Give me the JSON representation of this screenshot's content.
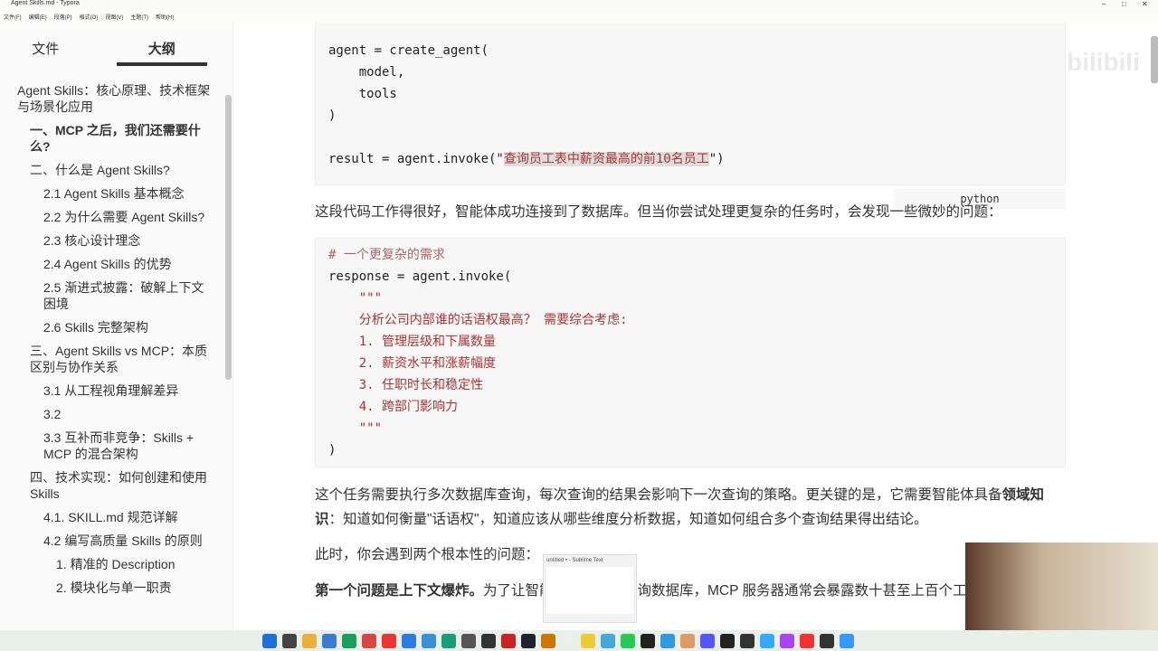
{
  "window": {
    "title": "Agent Skills.md - Typora"
  },
  "menu": [
    "文件(F)",
    "编辑(E)",
    "段落(P)",
    "格式(O)",
    "视图(V)",
    "主题(T)",
    "帮助(H)"
  ],
  "sidebar": {
    "tabs": [
      "文件",
      "大纲"
    ],
    "outline": [
      {
        "label": "Agent Skills：核心原理、技术框架与场景化应用",
        "level": 1
      },
      {
        "label": "一、MCP 之后，我们还需要什么?",
        "level": 2,
        "active": true
      },
      {
        "label": "二、什么是 Agent Skills?",
        "level": 2
      },
      {
        "label": "2.1 Agent Skills 基本概念",
        "level": 3
      },
      {
        "label": "2.2 为什么需要 Agent Skills?",
        "level": 3
      },
      {
        "label": "2.3 核心设计理念",
        "level": 3
      },
      {
        "label": "2.4 Agent Skills 的优势",
        "level": 3
      },
      {
        "label": "2.5 渐进式披露：破解上下文困境",
        "level": 3
      },
      {
        "label": "2.6 Skills 完整架构",
        "level": 3
      },
      {
        "label": "三、Agent Skills vs MCP：本质区别与协作关系",
        "level": 2
      },
      {
        "label": "3.1 从工程视角理解差异",
        "level": 3
      },
      {
        "label": "3.2",
        "level": 3
      },
      {
        "label": "3.3 互补而非竞争：Skills + MCP 的混合架构",
        "level": 3
      },
      {
        "label": "四、技术实现：如何创建和使用 Skills",
        "level": 2
      },
      {
        "label": "4.1. SKILL.md 规范详解",
        "level": 3
      },
      {
        "label": "4.2 编写高质量 Skills 的原则",
        "level": 3
      },
      {
        "label": "1. 精准的 Description",
        "level": 4
      },
      {
        "label": "2. 模块化与单一职责",
        "level": 4
      }
    ],
    "footer": {
      "back": "‹",
      "source": "</>"
    }
  },
  "code1": {
    "lines": [
      "agent = create_agent(",
      "    model,",
      "    tools",
      ")",
      "",
      "result = agent.invoke(\""
    ],
    "query": "查询员工表中薪资最高的前10名员工",
    "end": "\")",
    "lang": "python"
  },
  "p1": "这段代码工作得很好，智能体成功连接到了数据库。但当你尝试处理更复杂的任务时，会发现一些微妙的问题：",
  "code2": {
    "comment": "# 一个更复杂的需求",
    "l1": "response = agent.invoke(",
    "q1": "    \"\"\"",
    "s1": "    分析公司内部谁的话语权最高？ 需要综合考虑:",
    "items": [
      "    1. 管理层级和下属数量",
      "    2. 薪资水平和涨薪幅度",
      "    3. 任职时长和稳定性",
      "    4. 跨部门影响力"
    ],
    "q2": "    \"\"\"",
    "end": ")"
  },
  "p2a": "这个任务需要执行多次数据库查询，每次查询的结果会影响下一次查询的策略。更关键的是，它需要智能体具备",
  "p2b": "领域知识",
  "p2c": "：知道如何衡量\"话语权\"，知道应该从哪些维度分析数据，知道如何组合多个查询结果得出结论。",
  "p3": "此时，你会遇到两个根本性的问题：",
  "p4a": "第一个问题是上下文爆炸。",
  "p4b": "为了让智能体能够灵活查询数据库，MCP 服务器通常会暴露数十甚至上百个工具",
  "popup": "untitled • - Sublime Text",
  "watermark": "bilibili"
}
